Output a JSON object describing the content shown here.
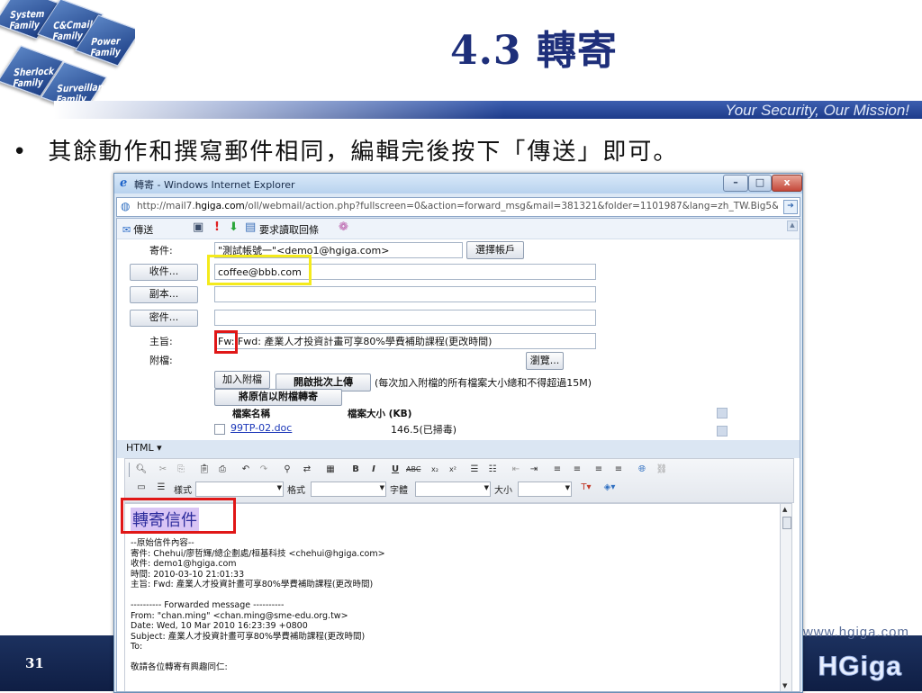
{
  "slide": {
    "title": "4.3 轉寄",
    "tagline": "Your Security, Our Mission!",
    "bullet": "其餘動作和撰寫郵件相同，編輯完後按下「傳送」即可。",
    "page_number": "31",
    "website": "www.hgiga.com",
    "brand": "HGiga",
    "logo_tiles": [
      "System Family",
      "C&Cmail Family",
      "Power Family",
      "Sherlock Family",
      "Surveillance Family"
    ]
  },
  "browser": {
    "title": "轉寄 - Windows Internet Explorer",
    "address_prefix": "http://mail7.",
    "address_host": "hgiga.com",
    "address_rest": "/oll/webmail/action.php?fullscreen=0&action=forward_msg&mail=381321&folder=1101987&lang=zh_TW.Big5&sort=8&sortdir=",
    "buttons": {
      "minimize": "–",
      "maximize": "□",
      "close": "x"
    }
  },
  "compose": {
    "toolbar": {
      "send_label": "傳送",
      "receipt_label": "要求讀取回條"
    },
    "sender_label": "寄件:",
    "sender_value": "\"測試帳號一\"<demo1@hgiga.com>",
    "choose_account": "選擇帳戶",
    "to_button": "收件...",
    "to_value": "coffee@bbb.com",
    "cc_button": "副本...",
    "cc_value": "",
    "bcc_button": "密件...",
    "bcc_value": "",
    "subject_label": "主旨:",
    "subject_value": "Fw: Fwd: 產業人才投資計畫可享80%學費補助課程(更改時間)",
    "attach_label": "附檔:",
    "browse_button": "瀏覽...",
    "add_attach_button": "加入附檔",
    "batch_upload_button": "開啟批次上傳",
    "attach_hint": "(每次加入附檔的所有檔案大小總和不得超過15M)",
    "forward_as_attachment_button": "將原信以附檔轉寄",
    "attach_table": {
      "headers": [
        "檔案名稱",
        "檔案大小 (KB)"
      ],
      "rows": [
        {
          "name": "99TP-02.doc",
          "size": "146.5(已掃毒)"
        }
      ]
    }
  },
  "editor": {
    "mode": "HTML",
    "combo_labels": {
      "style": "樣式",
      "format": "格式",
      "font": "字體",
      "size": "大小"
    },
    "heading": "轉寄信件",
    "quoted_lines": [
      "--原始信件內容--",
      "寄件: Chehui/廖哲輝/總企劃處/桓基科技 <chehui@hgiga.com>",
      "收件: demo1@hgiga.com",
      "時間: 2010-03-10 21:01:33",
      "主旨: Fwd: 產業人才投資計畫可享80%學費補助課程(更改時間)",
      "",
      "---------- Forwarded message ----------",
      "From: \"chan.ming\" <chan.ming@sme-edu.org.tw>",
      "Date: Wed, 10 Mar 2010 16:23:39 +0800",
      "Subject: 產業人才投資計畫可享80%學費補助課程(更改時間)",
      "To:",
      "",
      "敬請各位轉寄有興趣同仁:"
    ]
  },
  "colors": {
    "highlight_yellow": "#f4ea1c",
    "highlight_red": "#e01717",
    "title_blue": "#1e2f7a"
  }
}
